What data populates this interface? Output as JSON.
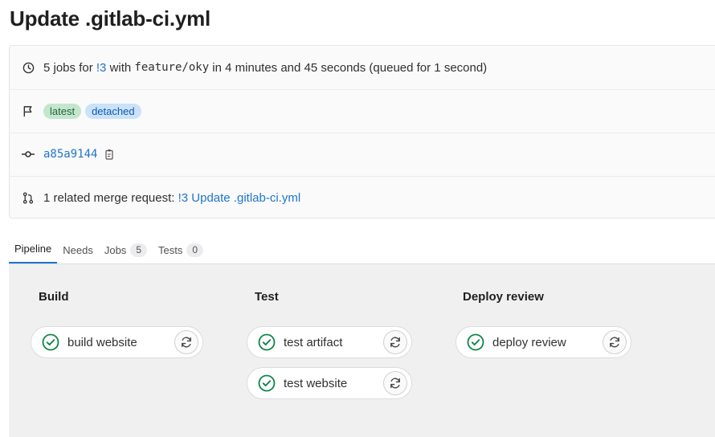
{
  "page": {
    "title": "Update .gitlab-ci.yml"
  },
  "summary": {
    "jobs_prefix": "5 jobs for ",
    "mr_link": "!3",
    "with_text": " with ",
    "branch": "feature/oky",
    "duration_text": " in 4 minutes and 45 seconds (queued for 1 second)",
    "badges": [
      "latest",
      "detached"
    ],
    "commit_sha": "a85a9144",
    "related_prefix": "1 related merge request: ",
    "related_link": "!3 Update .gitlab-ci.yml"
  },
  "tabs": {
    "pipeline": "Pipeline",
    "needs": "Needs",
    "jobs": "Jobs",
    "jobs_count": "5",
    "tests": "Tests",
    "tests_count": "0"
  },
  "stages": [
    {
      "name": "Build",
      "jobs": [
        "build website"
      ]
    },
    {
      "name": "Test",
      "jobs": [
        "test artifact",
        "test website"
      ]
    },
    {
      "name": "Deploy review",
      "jobs": [
        "deploy review"
      ]
    }
  ],
  "colors": {
    "link": "#1f75cb",
    "success": "#108548",
    "badge_latest_bg": "#c3e6cd",
    "badge_detached_bg": "#cbe2f9"
  },
  "icons": {
    "duration": "clock-icon",
    "badges": "flag-icon",
    "commit": "commit-icon",
    "copy": "copy-icon",
    "merge_request": "merge-request-icon",
    "status": "status-success-icon",
    "retry": "retry-icon"
  }
}
